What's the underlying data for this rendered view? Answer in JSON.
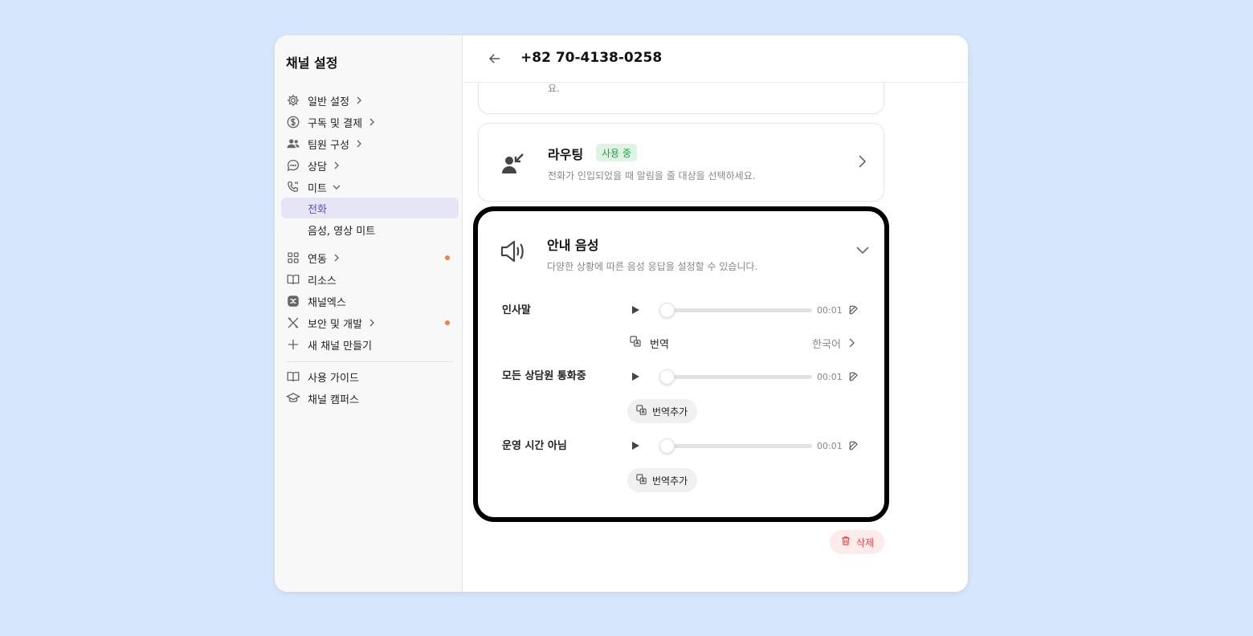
{
  "sidebar": {
    "title": "채널 설정",
    "items": [
      {
        "label": "일반 설정",
        "icon": "gear-icon"
      },
      {
        "label": "구독 및 결제",
        "icon": "dollar-circle-icon"
      },
      {
        "label": "팀원 구성",
        "icon": "people-icon"
      },
      {
        "label": "상담",
        "icon": "chat-bubble-icon"
      },
      {
        "label": "미트",
        "icon": "phone-icon"
      },
      {
        "label": "전화"
      },
      {
        "label": "음성, 영상 미트"
      },
      {
        "label": "연동",
        "icon": "grid-icon"
      },
      {
        "label": "리소스",
        "icon": "book-icon"
      },
      {
        "label": "채널엑스",
        "icon": "channelx-icon"
      },
      {
        "label": "보안 및 개발",
        "icon": "tools-icon"
      },
      {
        "label": "새 채널 만들기",
        "icon": "plus-icon"
      },
      {
        "label": "사용 가이드",
        "icon": "book-icon"
      },
      {
        "label": "채널 캠퍼스",
        "icon": "graduation-cap-icon"
      }
    ],
    "notification_color": "#f0813d",
    "active_color": "#5a4fcf"
  },
  "header": {
    "title": "+82 70-4138-0258"
  },
  "top_card": {
    "fragment": "요."
  },
  "routing": {
    "title": "라우팅",
    "badge": "사용 중",
    "description": "전화가 인입되었을 때 알림을 줄 대상을 선택하세요."
  },
  "voice": {
    "title": "안내 음성",
    "description": "다양한 상황에 따른 음성 응답을 설정할 수 있습니다.",
    "rows": [
      {
        "label": "인사말",
        "time": "00:01",
        "progress": 0
      },
      {
        "label": "모든 상담원 통화중",
        "time": "00:01",
        "progress": 0
      },
      {
        "label": "운영 시간 아님",
        "time": "00:01",
        "progress": 0
      }
    ],
    "translation": {
      "label": "번역",
      "language": "한국어"
    },
    "add_translation_label": "번역추가"
  },
  "delete_label": "삭제"
}
